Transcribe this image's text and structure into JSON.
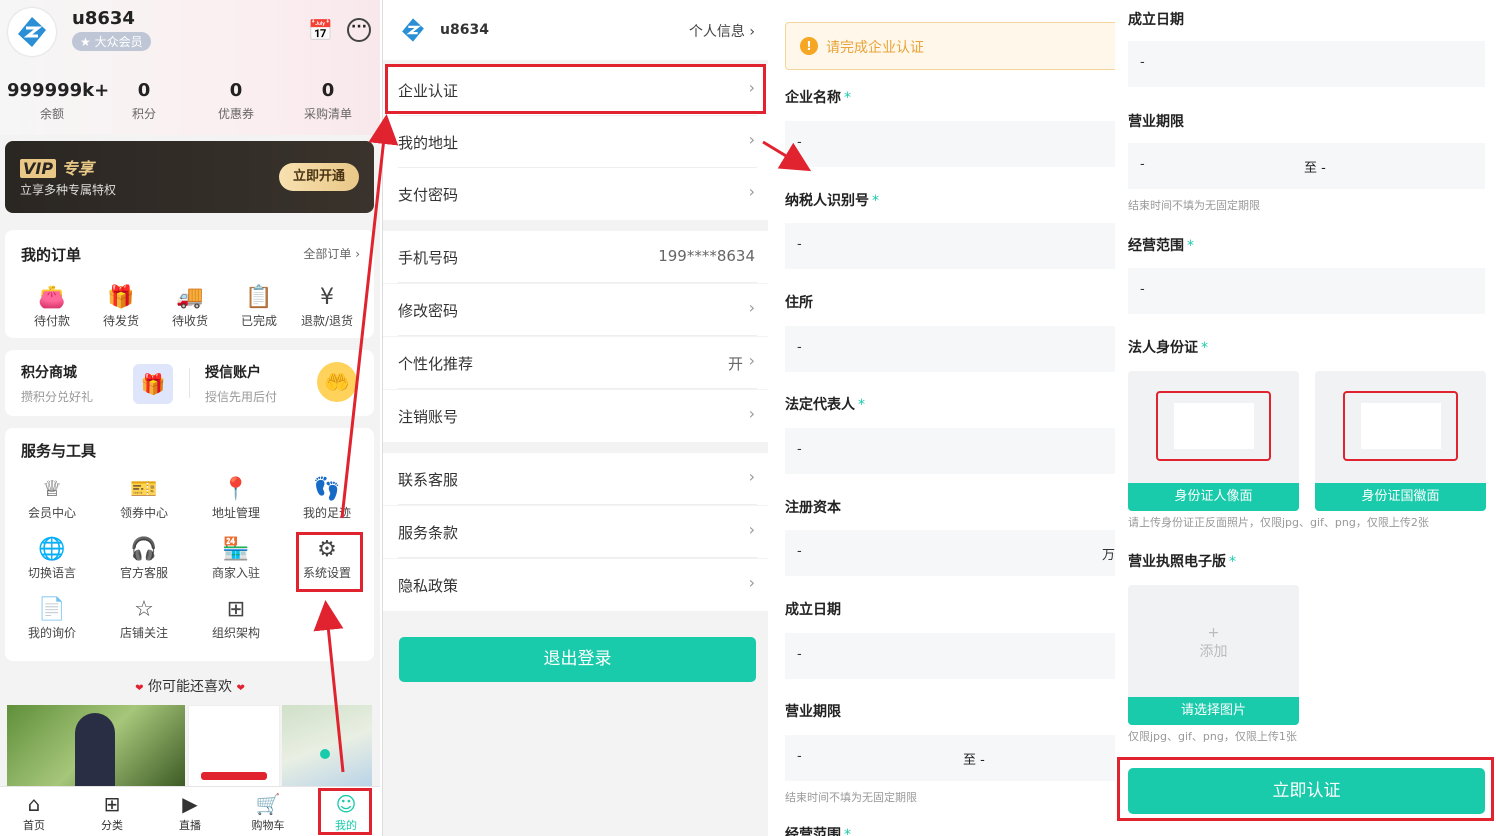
{
  "profile": {
    "username": "u8634",
    "member_badge": "大众会员"
  },
  "stats": [
    {
      "value": "999999k+",
      "label": "余额"
    },
    {
      "value": "0",
      "label": "积分"
    },
    {
      "value": "0",
      "label": "优惠券"
    },
    {
      "value": "0",
      "label": "采购清单"
    }
  ],
  "vip": {
    "logo": "VIP",
    "title": "专享",
    "desc": "立享多种专属特权",
    "button": "立即开通"
  },
  "orders": {
    "title": "我的订单",
    "all": "全部订单 ›",
    "items": [
      "待付款",
      "待发货",
      "待收货",
      "已完成",
      "退款/退货"
    ]
  },
  "promo": {
    "left_title": "积分商城",
    "left_sub": "攒积分兑好礼",
    "right_title": "授信账户",
    "right_sub": "授信先用后付"
  },
  "services": {
    "title": "服务与工具",
    "items": [
      "会员中心",
      "领券中心",
      "地址管理",
      "我的足迹",
      "切换语言",
      "官方客服",
      "商家入驻",
      "系统设置",
      "我的询价",
      "店铺关注",
      "组织架构"
    ]
  },
  "recommend": {
    "title": "你可能还喜欢",
    "heart": "❤"
  },
  "tabbar": [
    "首页",
    "分类",
    "直播",
    "购物车",
    "我的"
  ],
  "settings": {
    "username": "u8634",
    "personal_info": "个人信息",
    "rows": [
      {
        "label": "企业认证",
        "right": ""
      },
      {
        "label": "我的地址",
        "right": ""
      },
      {
        "label": "支付密码",
        "right": ""
      },
      {
        "label": "手机号码",
        "right": "199****8634"
      },
      {
        "label": "修改密码",
        "right": ""
      },
      {
        "label": "个性化推荐",
        "right": "开"
      },
      {
        "label": "注销账号",
        "right": ""
      },
      {
        "label": "联系客服",
        "right": ""
      },
      {
        "label": "服务条款",
        "right": ""
      },
      {
        "label": "隐私政策",
        "right": ""
      }
    ],
    "logout": "退出登录"
  },
  "form": {
    "notice": "请完成企业认证",
    "fields": {
      "company_name": "企业名称",
      "tax_id": "纳税人识别号",
      "address": "住所",
      "legal_rep": "法定代表人",
      "capital": "注册资本",
      "found_date": "成立日期",
      "term": "营业期限",
      "scope": "经营范围",
      "id_card": "法人身份证",
      "license": "营业执照电子版"
    },
    "placeholder": "-",
    "capital_unit": "万",
    "to": "至",
    "term_note": "结束时间不填为无固定期限",
    "scope_partial": "经营范围",
    "id_front": "身份证人像面",
    "id_back": "身份证国徽面",
    "id_note": "请上传身份证正反面照片，仅限jpg、gif、png，仅限上传2张",
    "upload_plus": "+",
    "upload_add": "添加",
    "upload_choose": "请选择图片",
    "license_note": "仅限jpg、gif、png，仅限上传1张",
    "submit": "立即认证"
  },
  "colors": {
    "accent": "#19cbab",
    "highlight": "#e0232f",
    "required": "#19cbab"
  }
}
